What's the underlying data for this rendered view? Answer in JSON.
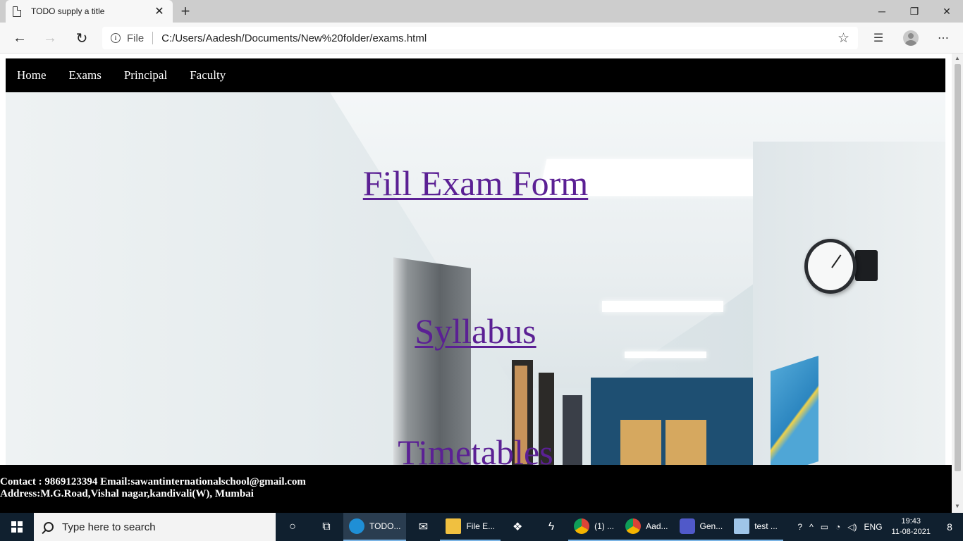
{
  "browser": {
    "tab_title": "TODO supply a title",
    "scheme_label": "File",
    "url": "C:/Users/Aadesh/Documents/New%20folder/exams.html",
    "window_controls": {
      "minimize": "─",
      "restore": "❐",
      "close": "✕"
    },
    "icons": [
      "page-icon",
      "close-icon",
      "plus-icon",
      "back-arrow-icon",
      "forward-arrow-icon",
      "refresh-icon",
      "info-icon",
      "star-icon",
      "favorites-icon",
      "profile-avatar",
      "more-icon"
    ]
  },
  "page": {
    "nav": [
      "Home",
      "Exams",
      "Principal",
      "Faculty"
    ],
    "links": {
      "fill_exam_form": "Fill Exam Form",
      "syllabus": "Syllabus",
      "timetables": "Timetables"
    },
    "footer": {
      "contact": "Contact : 9869123394 Email:sawantinternationalschool@gmail.com",
      "address": "Address:M.G.Road,Vishal nagar,kandivali(W), Mumbai"
    },
    "link_color": "#5b2094"
  },
  "taskbar": {
    "search_placeholder": "Type here to search",
    "apps": [
      {
        "label": "TODO...",
        "color": "#1f8fd6"
      },
      {
        "label": "File E...",
        "color": "#f0c040"
      },
      {
        "label": "(1) ...",
        "color": "#db4437"
      },
      {
        "label": "Aad...",
        "color": "#db4437"
      },
      {
        "label": "Gen...",
        "color": "#5059c9"
      },
      {
        "label": "test ...",
        "color": "#9fc5e8"
      }
    ],
    "language": "ENG",
    "time": "19:43",
    "date": "11-08-2021",
    "notification_count": "8"
  }
}
